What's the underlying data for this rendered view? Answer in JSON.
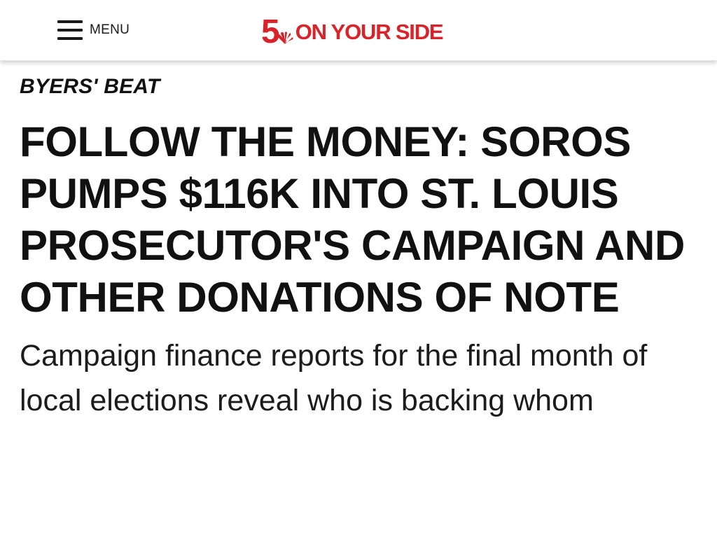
{
  "header": {
    "menu_label": "MENU",
    "menu_icon": "hamburger-menu-icon",
    "logo": {
      "number": "5",
      "icon": "peacock-icon",
      "text": "ON YOUR SIDE",
      "color": "#d8232a"
    }
  },
  "article": {
    "kicker": "BYERS' BEAT",
    "headline": "FOLLOW THE MONEY: SOROS PUMPS $116K INTO ST. LOUIS PROSECUTOR'S CAMPAIGN AND OTHER DONATIONS OF NOTE",
    "subheadline": "Campaign finance reports for the final month of local elections reveal who is backing whom"
  }
}
